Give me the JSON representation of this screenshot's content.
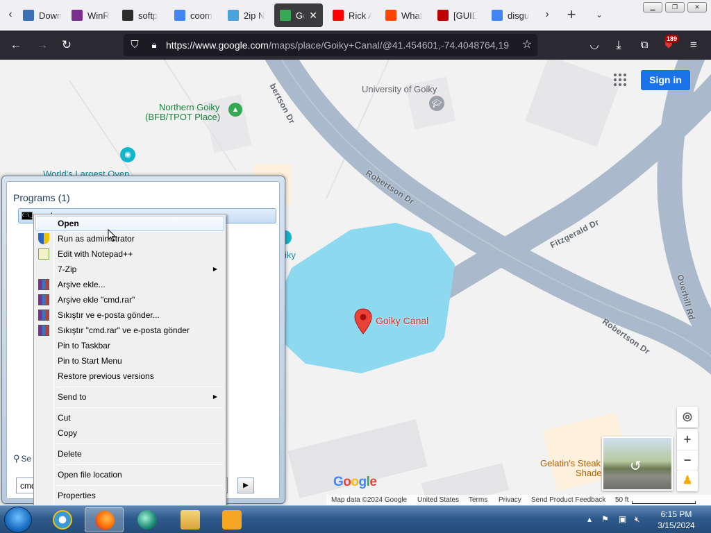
{
  "browser": {
    "tabs": [
      {
        "label": "Down",
        "icon": "download-icon",
        "color": "#3b6fb6"
      },
      {
        "label": "WinR",
        "icon": "winrar-icon",
        "color": "#7b2f8f"
      },
      {
        "label": "softp",
        "icon": "softpedia-icon",
        "color": "#2c2c2c"
      },
      {
        "label": "coom",
        "icon": "google-icon",
        "color": "#4285f4"
      },
      {
        "label": "2ip N",
        "icon": "2ip-icon",
        "color": "#4aa3df"
      },
      {
        "label": "Goi",
        "icon": "google-maps-icon",
        "color": "#34a853"
      },
      {
        "label": "Rick A",
        "icon": "youtube-icon",
        "color": "#ff0000"
      },
      {
        "label": "What",
        "icon": "reddit-icon",
        "color": "#ff4500"
      },
      {
        "label": "[GUID",
        "icon": "mt-icon",
        "color": "#c00000"
      },
      {
        "label": "disgu",
        "icon": "google-icon",
        "color": "#4285f4"
      }
    ],
    "url_main": "https://www.google.com",
    "url_rest": "/maps/place/Goiky+Canal/@41.454601,-74.4048764,19",
    "extension_badge": "189"
  },
  "map": {
    "labels": {
      "university": "University of Goiky",
      "northern_line1": "Northern Goiky",
      "northern_line2": "(BFB/TPOT Place)",
      "oven": "World's Largest Oven",
      "goiky_partial": "iky",
      "canal": "Goiky Canal",
      "gelatin_line1": "Gelatin's Steak",
      "gelatin_line2": "Shade"
    },
    "roads": {
      "robertson_1": "bertson Dr",
      "robertson_2": "Robertson Dr",
      "robertson_3": "Robertson Dr",
      "fitzgerald": "Fitzgerald Dr",
      "overhill": "Overhill Rd"
    },
    "signin": "Sign in",
    "google_logo": [
      "G",
      "o",
      "o",
      "g",
      "l",
      "e"
    ],
    "footer": {
      "map_data": "Map data ©2024 Google",
      "country": "United States",
      "terms": "Terms",
      "privacy": "Privacy",
      "feedback": "Send Product Feedback",
      "scale": "50 ft"
    },
    "colors": {
      "water": "#8dd9ef",
      "road": "#aab9cb",
      "pin": "#ea4335",
      "canal_label": "#d93025"
    }
  },
  "start_menu": {
    "heading": "Programs (1)",
    "item": "cmd",
    "see_more": "Se",
    "search_value": "cmd"
  },
  "context_menu": {
    "items": [
      {
        "label": "Open",
        "bold": true,
        "highlight": true
      },
      {
        "label": "Run as administrator",
        "icon": "shield-icon"
      },
      {
        "label": "Edit with Notepad++",
        "icon": "notepad-icon"
      },
      {
        "label": "7-Zip",
        "submenu": true
      },
      {
        "label": "Arşive ekle...",
        "icon": "winrar-icon"
      },
      {
        "label": "Arşive ekle \"cmd.rar\"",
        "icon": "winrar-icon"
      },
      {
        "label": "Sıkıştır ve e-posta gönder...",
        "icon": "winrar-icon"
      },
      {
        "label": "Sıkıştır \"cmd.rar\" ve e-posta gönder",
        "icon": "winrar-icon"
      },
      {
        "label": "Pin to Taskbar"
      },
      {
        "label": "Pin to Start Menu"
      },
      {
        "label": "Restore previous versions"
      },
      {
        "label": "Send to",
        "submenu": true
      },
      {
        "label": "Cut"
      },
      {
        "label": "Copy"
      },
      {
        "label": "Delete"
      },
      {
        "label": "Open file location"
      },
      {
        "label": "Properties"
      }
    ]
  },
  "taskbar": {
    "time": "6:15 PM",
    "date": "3/15/2024",
    "apps": [
      "internet-explorer-icon",
      "firefox-icon",
      "app-icon",
      "file-explorer-icon",
      "media-player-icon"
    ]
  }
}
